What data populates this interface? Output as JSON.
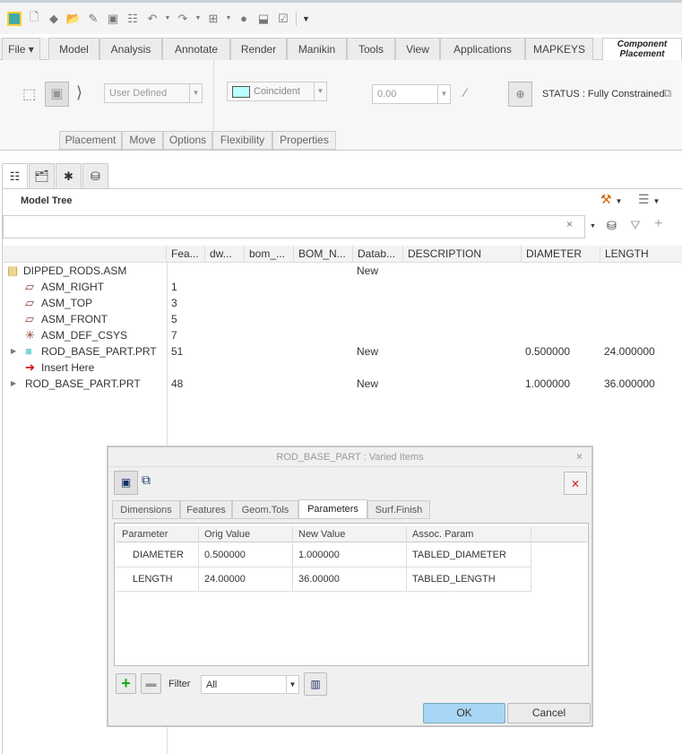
{
  "quick_access": {
    "icons": [
      "app-icon",
      "new-icon",
      "open-icon",
      "open-folder-icon",
      "save-as-icon",
      "save-icon",
      "regenerate-icon",
      "undo-icon",
      "redo-icon",
      "windows-icon",
      "render-icon",
      "close-icon",
      "manager-icon",
      "customize-icon"
    ]
  },
  "tabs": [
    "File ▾",
    "Model",
    "Analysis",
    "Annotate",
    "Render",
    "Manikin",
    "Tools",
    "View",
    "Applications",
    "MAPKEYS",
    "Component Placement"
  ],
  "ribbon": {
    "placement_type": "User Defined",
    "constraint": "Coincident",
    "offset": "0.00",
    "status": "STATUS : Fully Constrained",
    "panel_tabs": [
      "Placement",
      "Move",
      "Options",
      "Flexibility",
      "Properties"
    ]
  },
  "model_tree": {
    "title": "Model Tree",
    "search_value": "",
    "columns": [
      "Fea...",
      "dw...",
      "bom_...",
      "BOM_N...",
      "Datab...",
      "DESCRIPTION",
      "DIAMETER",
      "LENGTH"
    ],
    "rows": [
      {
        "name": "DIPPED_RODS.ASM",
        "icon": "assembly-icon",
        "feat": "",
        "db": "New",
        "diameter": "",
        "length": "",
        "indent": 0,
        "expand": false
      },
      {
        "name": "ASM_RIGHT",
        "icon": "datum-plane-icon",
        "feat": "1",
        "db": "",
        "diameter": "",
        "length": "",
        "indent": 1,
        "expand": false
      },
      {
        "name": "ASM_TOP",
        "icon": "datum-plane-icon",
        "feat": "3",
        "db": "",
        "diameter": "",
        "length": "",
        "indent": 1,
        "expand": false
      },
      {
        "name": "ASM_FRONT",
        "icon": "datum-plane-icon",
        "feat": "5",
        "db": "",
        "diameter": "",
        "length": "",
        "indent": 1,
        "expand": false
      },
      {
        "name": "ASM_DEF_CSYS",
        "icon": "csys-icon",
        "feat": "7",
        "db": "",
        "diameter": "",
        "length": "",
        "indent": 1,
        "expand": false
      },
      {
        "name": "ROD_BASE_PART.PRT",
        "icon": "part-icon",
        "feat": "51",
        "db": "New",
        "diameter": "0.500000",
        "length": "24.000000",
        "indent": 1,
        "expand": true
      },
      {
        "name": "Insert Here",
        "icon": "insert-arrow-icon",
        "feat": "",
        "db": "",
        "diameter": "",
        "length": "",
        "indent": 1,
        "expand": false
      },
      {
        "name": "ROD_BASE_PART.PRT",
        "icon": "",
        "feat": "48",
        "db": "New",
        "diameter": "1.000000",
        "length": "36.000000",
        "indent": 0,
        "expand": true
      }
    ]
  },
  "dialog": {
    "title": "ROD_BASE_PART : Varied Items",
    "tabs": [
      "Dimensions",
      "Features",
      "Geom.Tols",
      "Parameters",
      "Surf.Finish"
    ],
    "active_tab": "Parameters",
    "columns": [
      "Parameter",
      "Orig Value",
      "New Value",
      "Assoc. Param"
    ],
    "rows": [
      [
        "DIAMETER",
        "0.500000",
        "1.000000",
        "TABLED_DIAMETER"
      ],
      [
        "LENGTH",
        "24.00000",
        "36.00000",
        "TABLED_LENGTH"
      ]
    ],
    "filter_label": "Filter",
    "filter_value": "All",
    "ok": "OK",
    "cancel": "Cancel"
  },
  "colors": {
    "active_ok": "#a9d6f5",
    "insert_arrow": "#d00000",
    "part": "#7fd6d6"
  }
}
